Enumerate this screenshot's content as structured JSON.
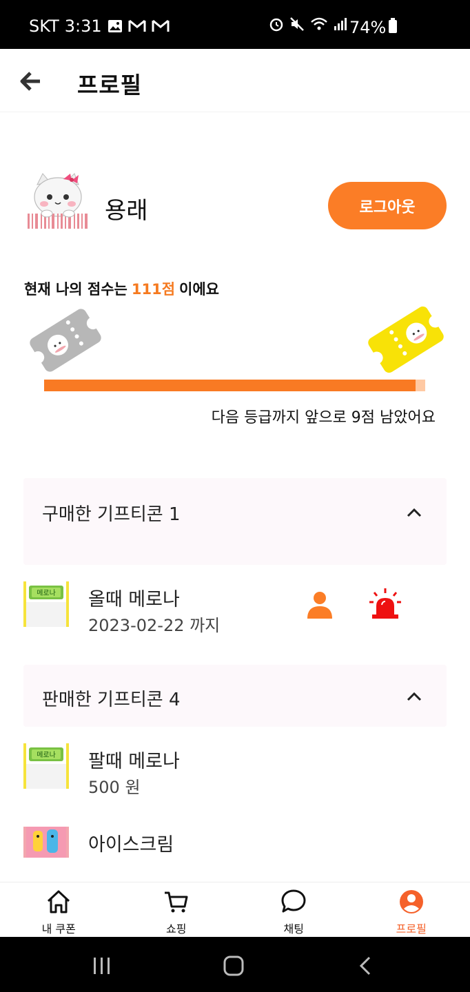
{
  "status_bar": {
    "carrier": "SKT",
    "time": "3:31",
    "battery": "74%"
  },
  "header": {
    "title": "프로필"
  },
  "profile": {
    "username": "용래",
    "logout_label": "로그아웃"
  },
  "score": {
    "prefix": "현재 나의 점수는",
    "value": "111점",
    "suffix": "이에요",
    "progress_fraction": 0.975,
    "next_grade_text": "다음 등급까지 앞으로 9점 남았어요"
  },
  "purchased": {
    "title": "구매한 기프티콘 1",
    "items": [
      {
        "name": "올때 메로나",
        "sub": "2023-02-22 까지"
      }
    ]
  },
  "sold": {
    "title": "판매한 기프티콘 4",
    "items": [
      {
        "name": "팔때 메로나",
        "sub": "500 원"
      },
      {
        "name": "아이스크림",
        "sub": ""
      }
    ]
  },
  "bottom_nav": {
    "items": [
      {
        "label": "내 쿠폰",
        "icon": "home-icon"
      },
      {
        "label": "쇼핑",
        "icon": "cart-icon"
      },
      {
        "label": "채팅",
        "icon": "chat-icon"
      },
      {
        "label": "프로필",
        "icon": "profile-icon"
      }
    ],
    "active_color": "#f5612a"
  },
  "colors": {
    "accent": "#fb7d26",
    "alert": "#ee1111"
  }
}
